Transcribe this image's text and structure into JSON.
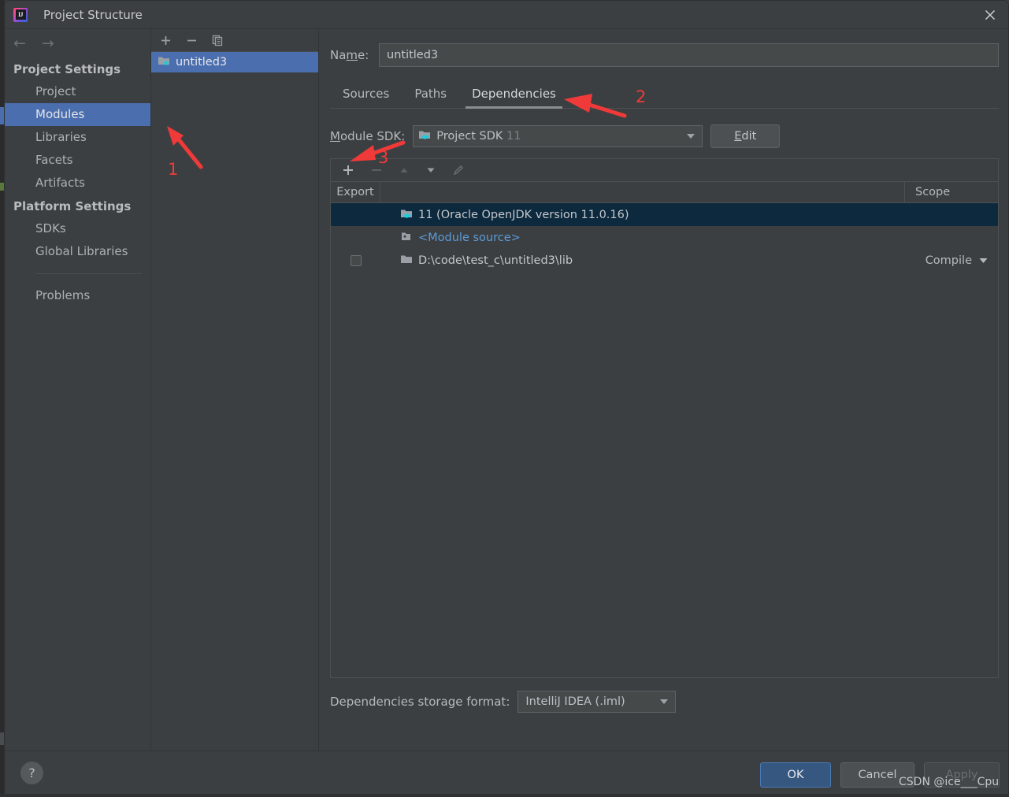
{
  "window": {
    "title": "Project Structure",
    "app_icon": "intellij-idea-logo",
    "close_icon": "close-icon"
  },
  "nav": {
    "back_icon": "arrow-left-icon",
    "forward_icon": "arrow-right-icon",
    "groups": [
      {
        "title": "Project Settings",
        "items": [
          {
            "label": "Project",
            "selected": false
          },
          {
            "label": "Modules",
            "selected": true
          },
          {
            "label": "Libraries",
            "selected": false
          },
          {
            "label": "Facets",
            "selected": false
          },
          {
            "label": "Artifacts",
            "selected": false
          }
        ]
      },
      {
        "title": "Platform Settings",
        "items": [
          {
            "label": "SDKs",
            "selected": false
          },
          {
            "label": "Global Libraries",
            "selected": false
          }
        ]
      }
    ],
    "problems_label": "Problems"
  },
  "modules_pane": {
    "toolbar": [
      {
        "icon": "plus-icon",
        "title": "add-module"
      },
      {
        "icon": "minus-icon",
        "title": "remove-module"
      },
      {
        "icon": "copy-icon",
        "title": "copy-module"
      }
    ],
    "items": [
      {
        "label": "untitled3",
        "icon": "module-folder-icon",
        "selected": true
      }
    ]
  },
  "detail": {
    "name_label": "Name:",
    "name_value": "untitled3",
    "tabs": [
      {
        "label": "Sources",
        "active": false
      },
      {
        "label": "Paths",
        "active": false
      },
      {
        "label": "Dependencies",
        "active": true
      }
    ],
    "sdk": {
      "label": "Module SDK:",
      "value": "Project SDK",
      "version": "11",
      "icon": "jdk-folder-icon",
      "edit_label": "Edit"
    },
    "dep_toolbar": [
      {
        "icon": "plus-icon",
        "title": "add-dependency",
        "enabled": true
      },
      {
        "icon": "minus-icon",
        "title": "remove-dependency",
        "enabled": false
      },
      {
        "icon": "arrow-up-icon",
        "title": "move-up",
        "enabled": false
      },
      {
        "icon": "arrow-down-icon",
        "title": "move-down",
        "enabled": true
      },
      {
        "icon": "pencil-icon",
        "title": "edit-dependency",
        "enabled": false
      }
    ],
    "table": {
      "columns": [
        "Export",
        "",
        "Scope"
      ],
      "rows": [
        {
          "export_checkbox": false,
          "show_checkbox": false,
          "icon": "jdk-folder-icon",
          "name": "11 (Oracle OpenJDK version 11.0.16)",
          "is_link": false,
          "scope": "",
          "selected": true
        },
        {
          "export_checkbox": false,
          "show_checkbox": false,
          "icon": "module-source-icon",
          "name": "<Module source>",
          "is_link": true,
          "scope": "",
          "selected": false
        },
        {
          "export_checkbox": false,
          "show_checkbox": true,
          "icon": "folder-icon",
          "name": "D:\\code\\test_c\\untitled3\\lib",
          "is_link": false,
          "scope": "Compile",
          "selected": false
        }
      ]
    },
    "storage": {
      "label": "Dependencies storage format:",
      "value": "IntelliJ IDEA (.iml)"
    }
  },
  "footer": {
    "help_label": "?",
    "buttons": [
      {
        "label": "OK",
        "kind": "primary"
      },
      {
        "label": "Cancel",
        "kind": "normal"
      },
      {
        "label": "Apply",
        "kind": "disabled"
      }
    ]
  },
  "annotations": {
    "color": "#f03a3a",
    "markers": [
      {
        "number": "1",
        "target": "modules-nav-item"
      },
      {
        "number": "2",
        "target": "dependencies-tab"
      },
      {
        "number": "3",
        "target": "add-dependency-button"
      }
    ],
    "watermark": "CSDN @ice___Cpu"
  }
}
